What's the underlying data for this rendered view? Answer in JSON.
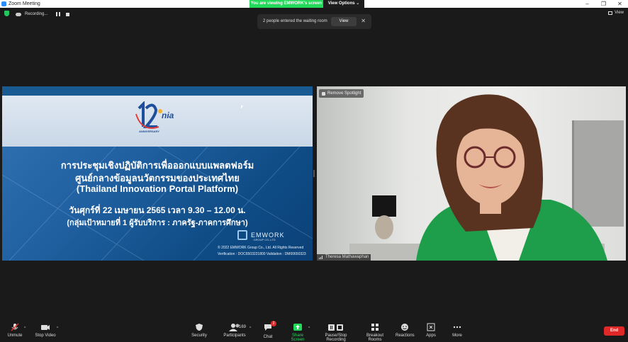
{
  "window": {
    "title": "Zoom Meeting",
    "controls": [
      "–",
      "❐",
      "✕"
    ]
  },
  "banner": {
    "viewing": "You are viewing EMWORK's screen",
    "view_options": "View Options ⌄"
  },
  "top": {
    "recording": "Recording...",
    "view": "View"
  },
  "notification": {
    "text": "2 people entered the waiting room",
    "button": "View",
    "close": "✕"
  },
  "slide": {
    "logo_number": "12",
    "logo_brand": "nia",
    "logo_anniversary": "ANNIVERSARY",
    "line1": "การประชุมเชิงปฏิบัติการเพื่อออกแบบแพลตฟอร์ม",
    "line2": "ศูนย์กลางข้อมูลนวัตกรรมของประเทศไทย",
    "line3": "(Thailand Innovation Portal Platform)",
    "line4": "วันศุกร์ที่ 22 เมษายน 2565 เวลา 9.30 – 12.00 น.",
    "line5": "(กลุ่มเป้าหมายที่ 1 ผู้รับบริการ : ภาครัฐ-ภาคการศึกษา)",
    "company": "EMWORK",
    "company_sub": "GROUP CO.,LTD",
    "copyright": "© 2022 EMWORK Group Co., Ltd. All Rights Reserved",
    "verification": "Verification : DOC6503221800   Validation : DM00650323"
  },
  "video": {
    "remove_spotlight": "Remove Spotlight",
    "participant_name": "Theresa Mathawaphan"
  },
  "toolbar": {
    "unmute": "Unmute",
    "stop_video": "Stop Video",
    "security": "Security",
    "participants": "Participants",
    "participants_count": "169",
    "chat": "Chat",
    "chat_badge": "2",
    "share_screen": "Share Screen",
    "pause_stop_recording": "Pause/Stop Recording",
    "breakout_rooms": "Breakout Rooms",
    "reactions": "Reactions",
    "apps": "Apps",
    "more": "More",
    "end": "End"
  },
  "colors": {
    "share_green": "#23d959",
    "end_red": "#e02828",
    "zoom_blue": "#2d8cff"
  }
}
